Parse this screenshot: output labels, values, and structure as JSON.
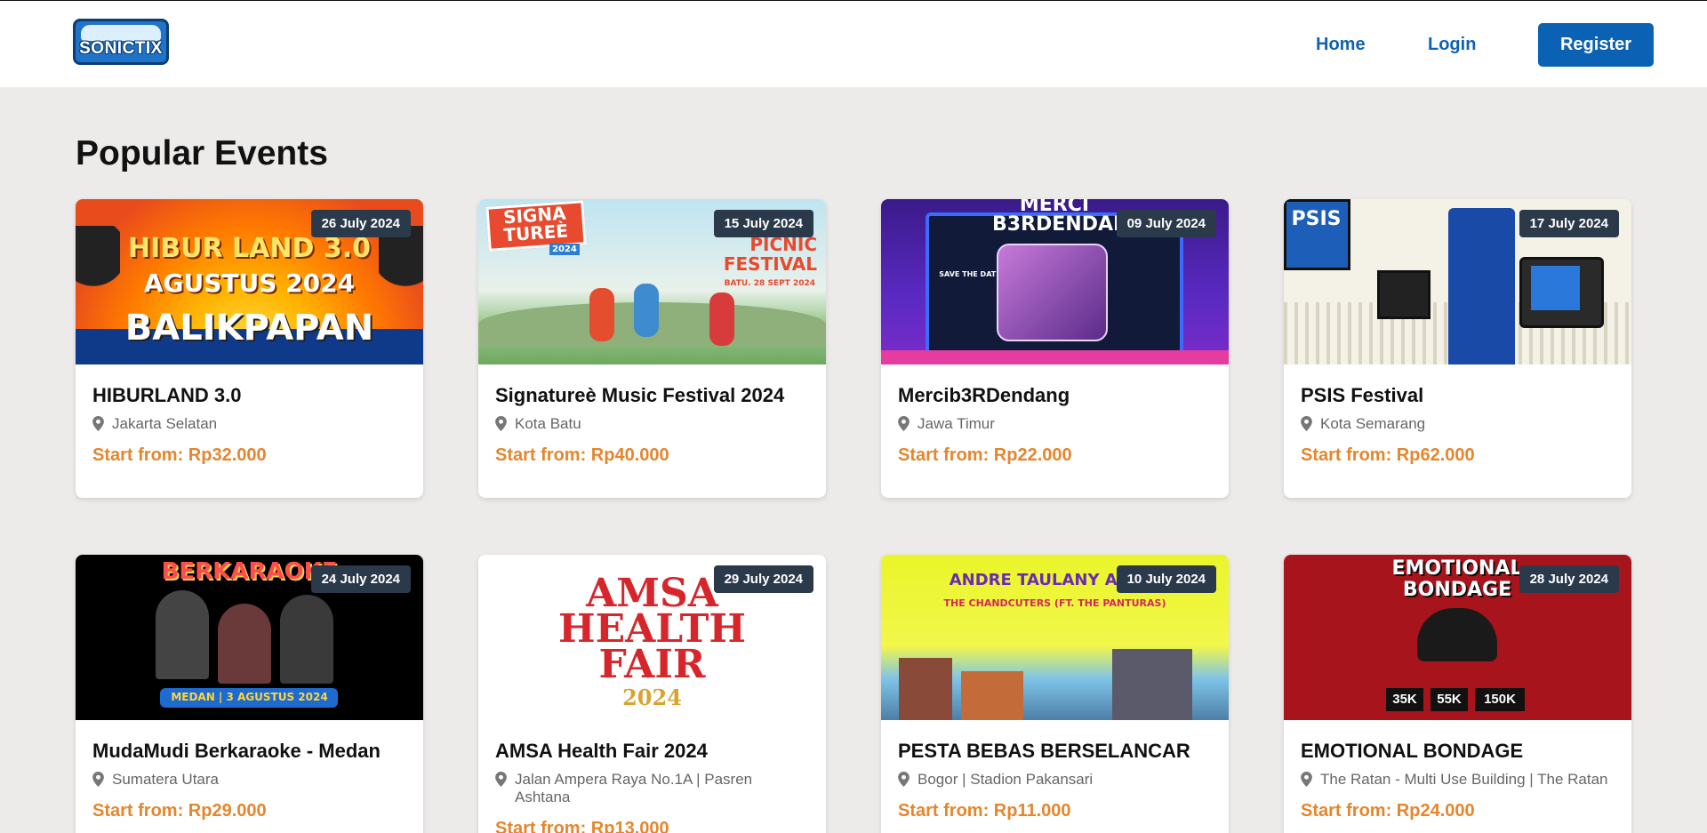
{
  "nav": {
    "logo_text": "SONICTIX",
    "home": "Home",
    "login": "Login",
    "register": "Register"
  },
  "section_title": "Popular Events",
  "events": [
    {
      "title": "HIBURLAND 3.0",
      "location": "Jakarta Selatan",
      "price": "Start from: Rp32.000",
      "date": "26 July 2024",
      "art": [
        "HIBUR LAND 3.0",
        "AGUSTUS 2024",
        "BALIKPAPAN"
      ]
    },
    {
      "title": "Signatureè Music Festival 2024",
      "location": "Kota Batu",
      "price": "Start from: Rp40.000",
      "date": "15 July 2024",
      "art": [
        "SIGNA TUREÈ",
        "2024",
        "PICNIC FESTIVAL",
        "BATU. 28 SEPT 2024"
      ]
    },
    {
      "title": "Mercib3RDendang",
      "location": "Jawa Timur",
      "price": "Start from: Rp22.000",
      "date": "09 July 2024",
      "art": [
        "MERCI B3RDENDANG",
        "SAVE THE DATE"
      ]
    },
    {
      "title": "PSIS Festival",
      "location": "Kota Semarang",
      "price": "Start from: Rp62.000",
      "date": "17 July 2024",
      "art": [
        "PSIS"
      ]
    },
    {
      "title": "MudaMudi Berkaraoke - Medan",
      "location": "Sumatera Utara",
      "price": "Start from: Rp29.000",
      "date": "24 July 2024",
      "art": [
        "BERKARAOKE",
        "MEDAN | 3 AGUSTUS 2024"
      ]
    },
    {
      "title": "AMSA Health Fair 2024",
      "location": "Jalan Ampera Raya No.1A | Pasren Ashtana",
      "price": "Start from: Rp13.000",
      "date": "29 July 2024",
      "art": [
        "AMSA",
        "HEALTH",
        "FAIR",
        "2024"
      ]
    },
    {
      "title": "PESTA BEBAS BERSELANCAR",
      "location": "Bogor | Stadion Pakansari",
      "price": "Start from: Rp11.000",
      "date": "10 July 2024",
      "art": [
        "ANDRE TAULANY AND F",
        "THE CHANDCUTERS (FT. THE PANTURAS)"
      ]
    },
    {
      "title": "EMOTIONAL BONDAGE",
      "location": "The Ratan - Multi Use Building | The Ratan",
      "price": "Start from: Rp24.000",
      "date": "28 July 2024",
      "art": [
        "EMOTIONAL BONDAGE",
        "35K",
        "55K",
        "150K"
      ]
    }
  ],
  "colors": {
    "primary": "#0b61b3",
    "price": "#e5862d",
    "badge": "#2b3a4a",
    "background": "#ecebea"
  },
  "icons": {
    "location": "map-pin-icon"
  }
}
